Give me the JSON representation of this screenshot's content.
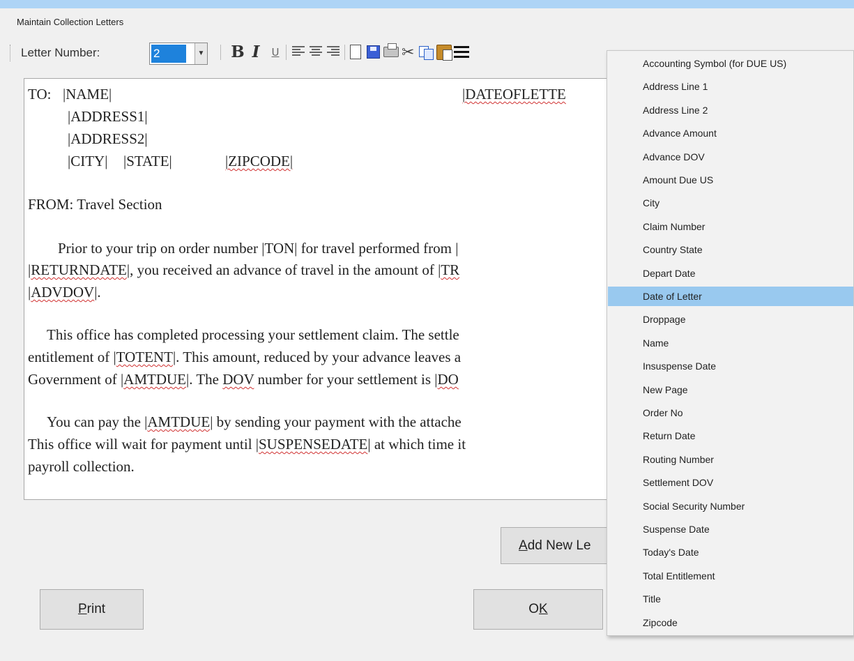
{
  "window": {
    "title": "Maintain Collection Letters"
  },
  "toolbar": {
    "letter_number_label": "Letter Number:",
    "letter_number_value": "2",
    "bold": "B",
    "italic": "I",
    "underline": "U"
  },
  "editor": {
    "to_label": "TO:",
    "name_field": "|NAME|",
    "date_field": "|DATEOFLETTE",
    "address1": "|ADDRESS1|",
    "address2": "|ADDRESS2|",
    "city": "|CITY|",
    "state": "|STATE|",
    "zipcode": "|ZIPCODE|",
    "from_line": "FROM:  Travel Section",
    "p1_a": "Prior to your trip on order number |TON| for travel performed   from |",
    "p1_b_field": "RETURNDATE",
    "p1_b_rest": "|, you received an advance of travel in the amount of |",
    "p1_b_tr": "TR",
    "p1_c_field": "ADVDOV",
    "p1_c_rest": "|.",
    "p2_a": "This office has completed processing your settlement claim.  The settle",
    "p2_b_pre": "entitlement of |",
    "p2_b_field": "TOTENT",
    "p2_b_rest": "|.  This amount, reduced by your advance leaves a",
    "p2_c_pre": "Government of |",
    "p2_c_field": "AMTDUE",
    "p2_c_mid": "|.  The ",
    "p2_c_dov": "DOV",
    "p2_c_rest": " number for your settlement is |",
    "p2_c_do": "DO",
    "p3_a_pre": "You can pay the |",
    "p3_a_field": "AMTDUE",
    "p3_a_rest": "| by sending your payment with the attache",
    "p3_b_pre": "This office will wait for payment until |",
    "p3_b_field": "SUSPENSEDATE",
    "p3_b_rest": "| at which time it",
    "p3_c": "payroll collection."
  },
  "buttons": {
    "add_new_letter": "Add New Le",
    "print_first": "P",
    "print_rest": "rint",
    "ok_first": "O",
    "ok_rest": "K"
  },
  "dropdown": {
    "selected_index": 10,
    "items": [
      "Accounting Symbol (for DUE US)",
      "Address Line 1",
      "Address Line 2",
      "Advance Amount",
      "Advance DOV",
      "Amount Due US",
      "City",
      "Claim Number",
      "Country State",
      "Depart Date",
      "Date of Letter",
      "Droppage",
      "Name",
      "Insuspense Date",
      "New Page",
      "Order No",
      "Return Date",
      "Routing Number",
      "Settlement DOV",
      "Social Security Number",
      "Suspense Date",
      "Today's Date",
      "Total Entitlement",
      "Title",
      "Zipcode"
    ]
  }
}
